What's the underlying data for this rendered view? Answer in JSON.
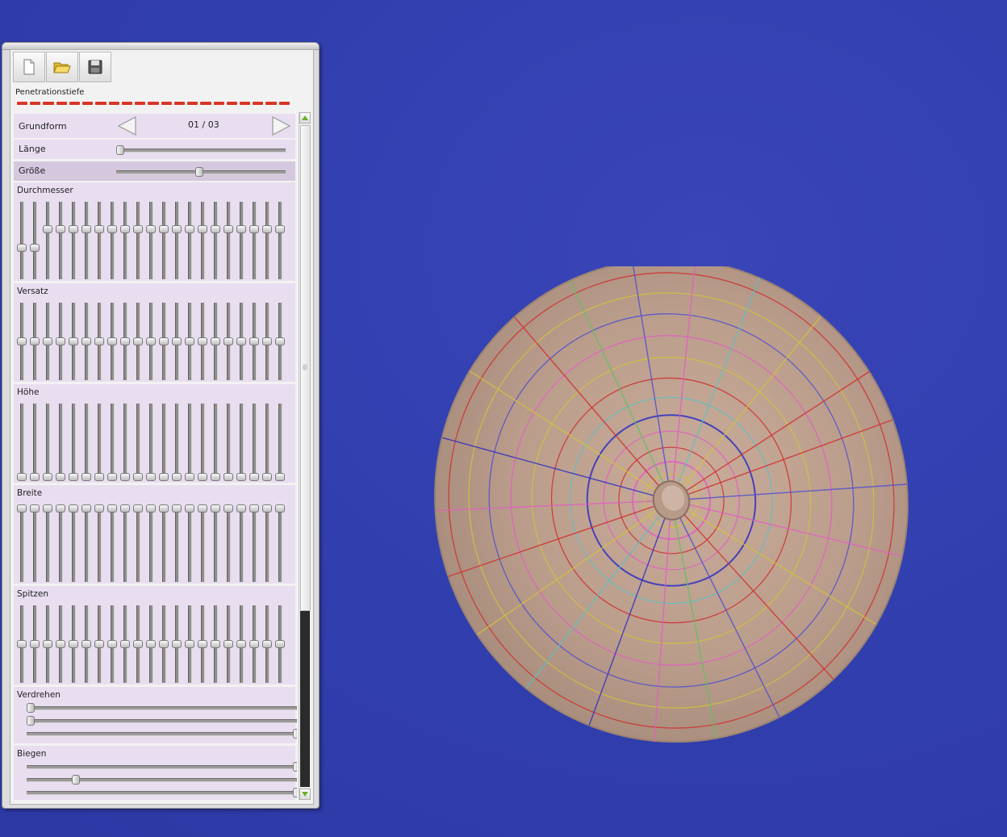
{
  "toolbar": {
    "buttons": [
      {
        "icon": "new-document-icon"
      },
      {
        "icon": "open-folder-icon"
      },
      {
        "icon": "save-disk-icon"
      }
    ]
  },
  "penetration": {
    "label": "Penetrationstiefe",
    "segments": 21,
    "color": "#d93526"
  },
  "grundform": {
    "label": "Grundform",
    "counter": "01 / 03"
  },
  "laenge": {
    "label": "Länge",
    "value": 0.0
  },
  "groesse": {
    "label": "Größe",
    "value": 0.49
  },
  "sections": [
    {
      "key": "durchmesser",
      "label": "Durchmesser",
      "values": [
        0.4,
        0.4,
        0.66,
        0.66,
        0.66,
        0.66,
        0.66,
        0.66,
        0.66,
        0.66,
        0.66,
        0.66,
        0.66,
        0.66,
        0.66,
        0.66,
        0.66,
        0.66,
        0.66,
        0.66,
        0.66
      ]
    },
    {
      "key": "versatz",
      "label": "Versatz",
      "values": [
        0.5,
        0.5,
        0.5,
        0.5,
        0.5,
        0.5,
        0.5,
        0.5,
        0.5,
        0.5,
        0.5,
        0.5,
        0.5,
        0.5,
        0.5,
        0.5,
        0.5,
        0.5,
        0.5,
        0.5,
        0.5
      ]
    },
    {
      "key": "hoehe",
      "label": "Höhe",
      "values": [
        0,
        0,
        0,
        0,
        0,
        0,
        0,
        0,
        0,
        0,
        0,
        0,
        0,
        0,
        0,
        0,
        0,
        0,
        0,
        0,
        0
      ]
    },
    {
      "key": "breite",
      "label": "Breite",
      "values": [
        1,
        1,
        1,
        1,
        1,
        1,
        1,
        1,
        1,
        1,
        1,
        1,
        1,
        1,
        1,
        1,
        1,
        1,
        1,
        1,
        1
      ]
    },
    {
      "key": "spitzen",
      "label": "Spitzen",
      "values": [
        0.5,
        0.5,
        0.5,
        0.5,
        0.5,
        0.5,
        0.5,
        0.5,
        0.5,
        0.5,
        0.5,
        0.5,
        0.5,
        0.5,
        0.5,
        0.5,
        0.5,
        0.5,
        0.5,
        0.5,
        0.5
      ]
    }
  ],
  "verdrehen": {
    "label": "Verdrehen",
    "values": [
      0.0,
      0.0,
      1.0
    ]
  },
  "biegen": {
    "label": "Biegen",
    "values": [
      1.0,
      0.17,
      1.0
    ]
  },
  "viewport": {
    "background": "#3240b0"
  }
}
